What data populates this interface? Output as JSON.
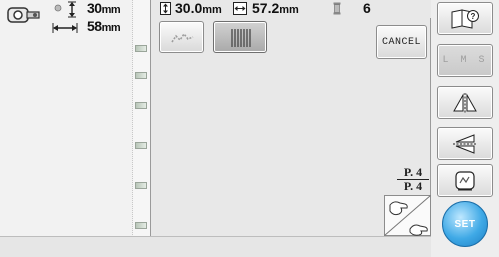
{
  "design_size": {
    "height_value": "30",
    "width_value": "58",
    "unit": "mm"
  },
  "toolbar": {
    "height_value": "30.0",
    "width_value": "57.2",
    "unit": "mm",
    "color_count": "6"
  },
  "buttons": {
    "cancel_label": "CANCEL",
    "lms_label": "L M S",
    "set_label": "SET"
  },
  "page": {
    "current": "P. 4",
    "total": "P. 4"
  },
  "colors": {
    "accent": "#3fa9e6",
    "panel": "#e8e8e8"
  },
  "icons": [
    "embroidery-foot-icon",
    "size-arrows-icon",
    "vertical-size-icon",
    "horizontal-size-icon",
    "thread-spool-icon",
    "stitch-type-a-icon",
    "stitch-type-b-icon",
    "help-book-icon",
    "mirror-icon",
    "flip-icon",
    "density-icon",
    "page-turn-icon"
  ]
}
